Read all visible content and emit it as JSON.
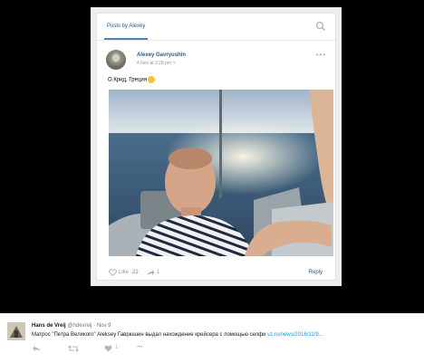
{
  "post": {
    "tab_label": "Posts by Alexey",
    "author": "Alexey Gavryushin",
    "date": "4 Nov at 2:28 pm",
    "text": "О.Крид, Греция",
    "like_label": "Like",
    "like_count": "22",
    "share_count": "1",
    "reply_label": "Reply"
  },
  "tweet": {
    "name": "Hans de Vreij",
    "handle": "@hdevreij",
    "separator": "·",
    "date": "Nov 9",
    "text": "Матрос \"Петра Великого\" Aleksey Гаврюшин выдал нахождение крейсера с помощью селфи",
    "link": "vz.ru/news/2016/11/9…",
    "retweet_count": "",
    "like_count": "1",
    "more": "•••"
  },
  "icons": [
    "search-icon",
    "more-options-icon",
    "heart-icon",
    "share-icon",
    "reply-icon",
    "retweet-icon",
    "like-icon",
    "more-icon",
    "smile-emoji"
  ]
}
